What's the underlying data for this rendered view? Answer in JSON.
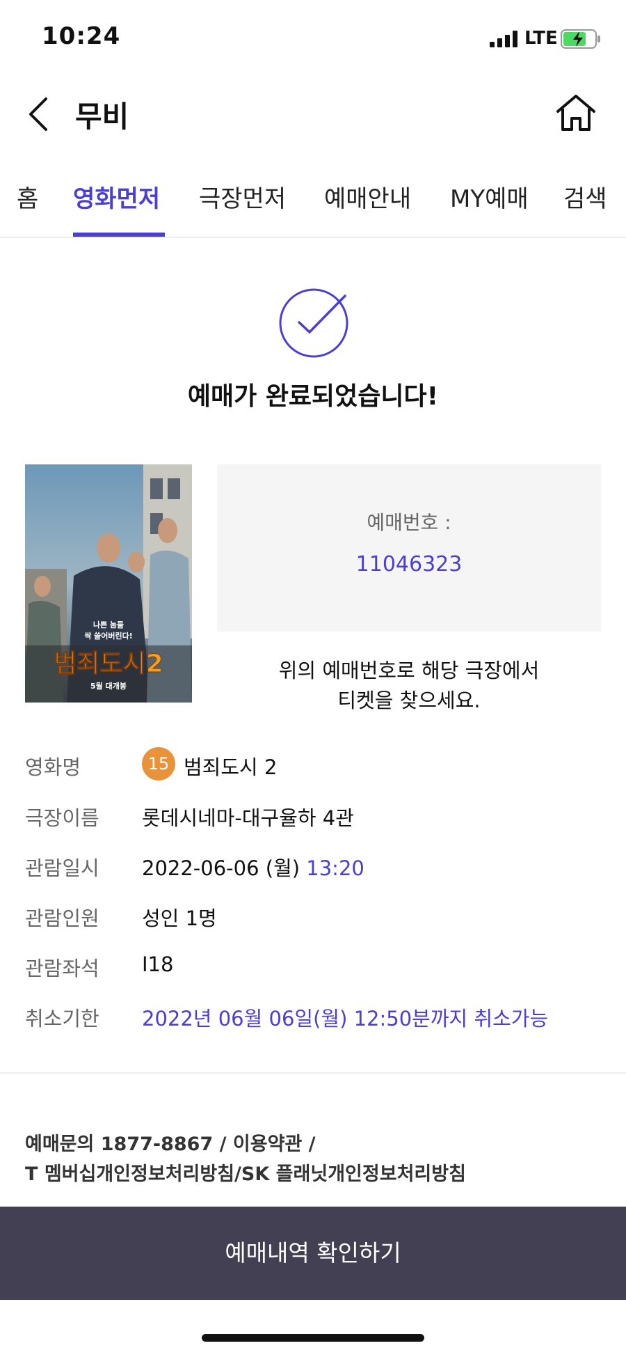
{
  "status_bar": {
    "time": "10:24",
    "network": "LTE"
  },
  "header": {
    "title": "무비"
  },
  "tabs": [
    {
      "label": "홈",
      "active": false
    },
    {
      "label": "영화먼저",
      "active": true
    },
    {
      "label": "극장먼저",
      "active": false
    },
    {
      "label": "예매안내",
      "active": false
    },
    {
      "label": "MY예매",
      "active": false
    },
    {
      "label": "검색",
      "active": false
    }
  ],
  "complete_message": "예매가 완료되었습니다!",
  "poster": {
    "tagline_line1": "나쁜 놈들",
    "tagline_line2": "싹 쓸어버린다!",
    "title_text": "범죄도시2",
    "release_text": "5월 대개봉"
  },
  "booking": {
    "label": "예매번호 :",
    "number": "11046323"
  },
  "find_message": {
    "line1": "위의 예매번호로 해당 극장에서",
    "line2": "티켓을 찾으세요."
  },
  "details": {
    "movie": {
      "label": "영화명",
      "rating": "15",
      "value": "범죄도시 2"
    },
    "theater": {
      "label": "극장이름",
      "value": "롯데시네마-대구율하 4관"
    },
    "datetime": {
      "label": "관람일시",
      "date": "2022-06-06 (월) ",
      "time": "13:20"
    },
    "people": {
      "label": "관람인원",
      "value": "성인 1명"
    },
    "seat": {
      "label": "관람좌석",
      "value": "I18"
    },
    "cancel": {
      "label": "취소기한",
      "value": "2022년 06월 06일(월) 12:50분까지 취소가능"
    }
  },
  "footer": {
    "line1": "예매문의 1877-8867 / 이용약관 /",
    "line2": "T 멤버십개인정보처리방침/SK 플래닛개인정보처리방침"
  },
  "confirm_button": "예매내역 확인하기",
  "colors": {
    "accent": "#4a3fd0",
    "button_bg": "#434053",
    "rating_badge": "#e8933a"
  }
}
